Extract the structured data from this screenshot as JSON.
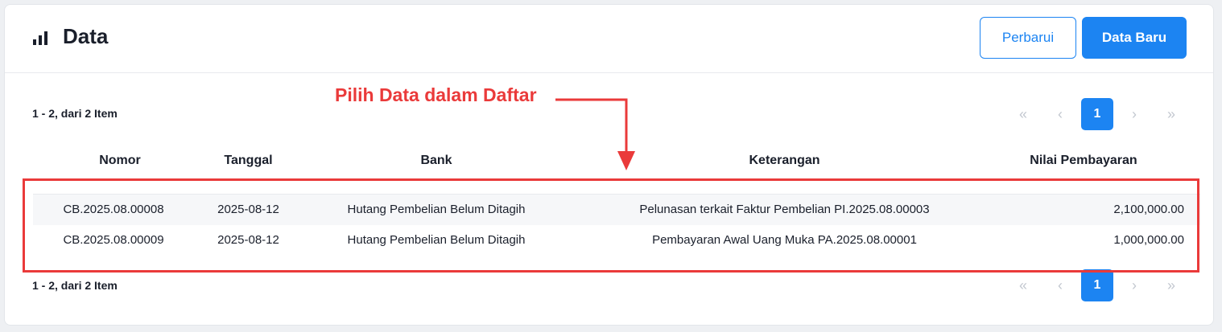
{
  "header": {
    "title": "Data",
    "title_icon": "bar-chart-icon",
    "refresh_label": "Perbarui",
    "new_label": "Data Baru"
  },
  "pagination": {
    "summary": "1 - 2, dari 2 Item",
    "first": "«",
    "prev": "‹",
    "current": "1",
    "next": "›",
    "last": "»"
  },
  "annotation": {
    "text": "Pilih Data dalam Daftar"
  },
  "table": {
    "columns": [
      "Nomor",
      "Tanggal",
      "Bank",
      "Keterangan",
      "Nilai Pembayaran"
    ],
    "rows": [
      {
        "nomor": "CB.2025.08.00008",
        "tanggal": "2025-08-12",
        "bank": "Hutang Pembelian Belum Ditagih",
        "keterangan": "Pelunasan terkait Faktur Pembelian PI.2025.08.00003",
        "nilai": "2,100,000.00"
      },
      {
        "nomor": "CB.2025.08.00009",
        "tanggal": "2025-08-12",
        "bank": "Hutang Pembelian Belum Ditagih",
        "keterangan": "Pembayaran Awal Uang Muka PA.2025.08.00001",
        "nilai": "1,000,000.00"
      }
    ]
  },
  "colors": {
    "primary": "#1c84f2",
    "annotation": "#ea3a3a",
    "text": "#1a1f2b"
  }
}
